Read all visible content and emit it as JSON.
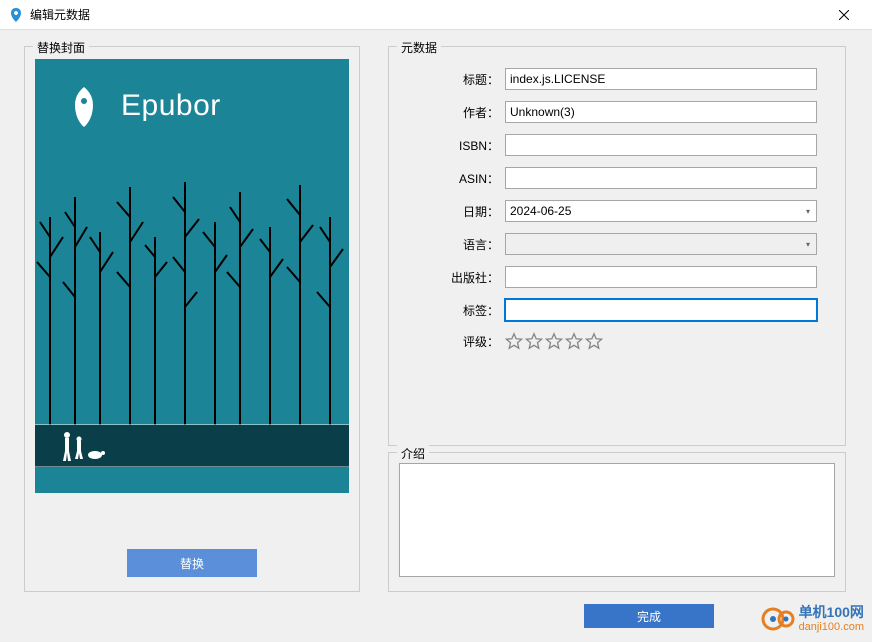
{
  "window": {
    "title": "编辑元数据",
    "close_icon": "close"
  },
  "cover": {
    "legend": "替换封面",
    "brand": "Epubor",
    "replace_button": "替换"
  },
  "metadata": {
    "legend": "元数据",
    "fields": {
      "title": {
        "label": "标题：",
        "value": "index.js.LICENSE"
      },
      "author": {
        "label": "作者：",
        "value": "Unknown(3)"
      },
      "isbn": {
        "label": "ISBN：",
        "value": ""
      },
      "asin": {
        "label": "ASIN：",
        "value": ""
      },
      "date": {
        "label": "日期：",
        "value": "2024-06-25"
      },
      "language": {
        "label": "语言：",
        "value": ""
      },
      "publisher": {
        "label": "出版社：",
        "value": ""
      },
      "tags": {
        "label": "标签：",
        "value": ""
      },
      "rating": {
        "label": "评级：",
        "value": 0,
        "max": 5
      }
    }
  },
  "intro": {
    "legend": "介绍",
    "value": ""
  },
  "buttons": {
    "finish": "完成"
  },
  "watermark": {
    "line1": "单机100网",
    "line2": "danji100.com"
  }
}
